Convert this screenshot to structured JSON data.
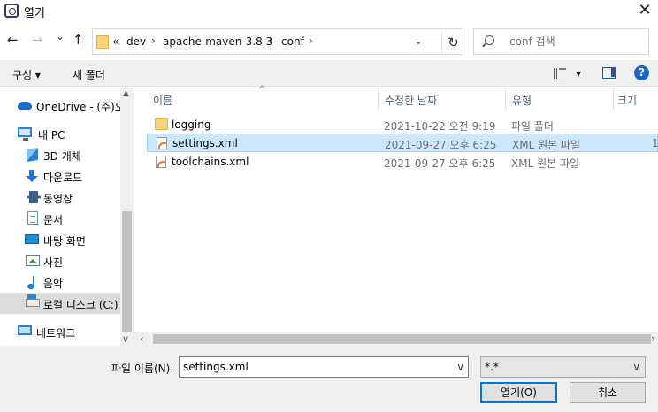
{
  "window": {
    "title": "열기",
    "close_glyph": "✕"
  },
  "nav": {
    "back": "←",
    "forward": "→",
    "recent": "⌄",
    "up": "↑"
  },
  "address": {
    "overflow": "«",
    "crumbs": [
      "dev",
      "apache-maven-3.8.3",
      "conf"
    ],
    "separator": "›",
    "dropdown": "⌄",
    "refresh": "↻"
  },
  "search": {
    "placeholder": "conf 검색"
  },
  "toolbar": {
    "organize": "구성 ▾",
    "new_folder": "새 폴더",
    "view_dropdown": "▾",
    "help": "?"
  },
  "sidebar": {
    "items": [
      {
        "label": "OneDrive - (주)오",
        "icon": "onedrive-icon"
      },
      {
        "label": "내 PC",
        "icon": "pc-icon"
      },
      {
        "label": "3D 개체",
        "icon": "3d-objects-icon"
      },
      {
        "label": "다운로드",
        "icon": "downloads-icon"
      },
      {
        "label": "동영상",
        "icon": "videos-icon"
      },
      {
        "label": "문서",
        "icon": "documents-icon"
      },
      {
        "label": "바탕 화면",
        "icon": "desktop-icon"
      },
      {
        "label": "사진",
        "icon": "pictures-icon"
      },
      {
        "label": "음악",
        "icon": "music-icon"
      },
      {
        "label": "로컬 디스크 (C:)",
        "icon": "local-disk-icon",
        "selected": true
      },
      {
        "label": "네트워크",
        "icon": "network-icon"
      }
    ]
  },
  "columns": {
    "name": "이름",
    "modified": "수정한 날짜",
    "type": "유형",
    "size": "크기",
    "sort_glyph": "^"
  },
  "files": [
    {
      "name": "logging",
      "modified": "2021-10-22 오전 9:19",
      "type": "파일 폴더",
      "size": "",
      "icon": "folder-icon"
    },
    {
      "name": "settings.xml",
      "modified": "2021-09-27 오후 6:25",
      "type": "XML 원본 파일",
      "size": "1",
      "icon": "xml-file-icon",
      "selected": true
    },
    {
      "name": "toolchains.xml",
      "modified": "2021-09-27 오후 6:25",
      "type": "XML 원본 파일",
      "size": "",
      "icon": "xml-file-icon"
    }
  ],
  "scroll": {
    "up": "▲",
    "down": "∨",
    "left": "‹",
    "right": "›"
  },
  "bottom": {
    "filename_label": "파일 이름(N):",
    "filename_value": "settings.xml",
    "filename_dropdown": "∨",
    "filter_value": "*.*",
    "filter_dropdown": "∨",
    "open_button": "열기(O)",
    "cancel_button": "취소"
  },
  "colors": {
    "selection_bg": "#cce8ff",
    "selection_border": "#99d1ff",
    "accent": "#0078d7"
  }
}
